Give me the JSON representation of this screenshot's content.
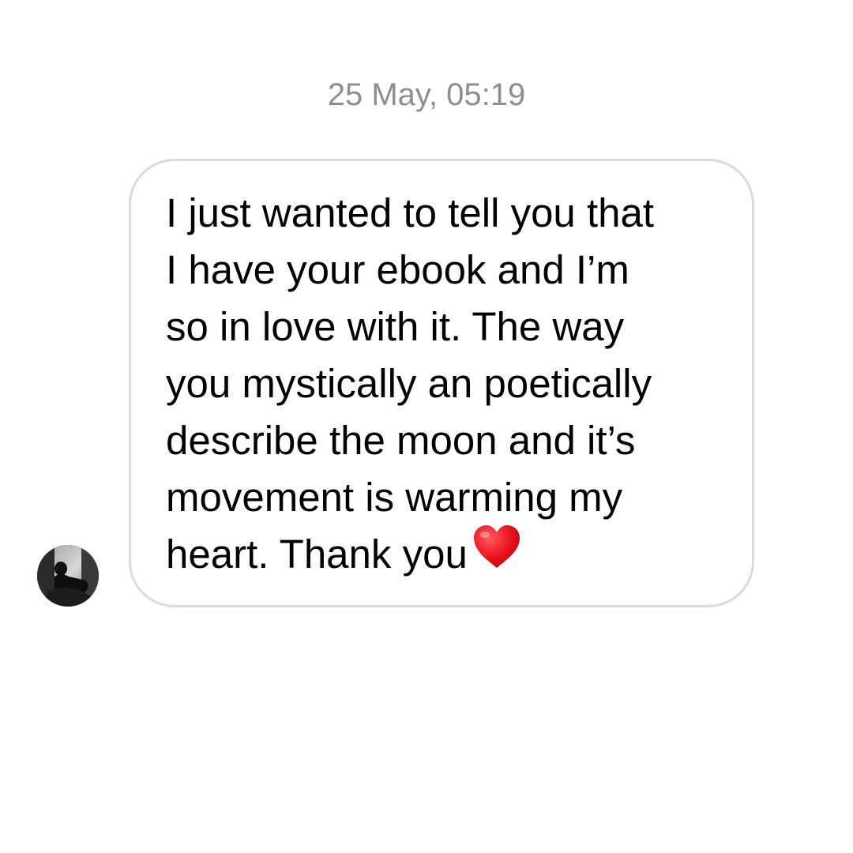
{
  "thread": {
    "timestamp": "25 May, 05:19",
    "message": {
      "text": "I just wanted to tell you that\nI have your ebook and I’m\nso in love with it. The way\nyou mystically an poetically\ndescribe the moon and it’s\nmovement is warming my\nheart. Thank you",
      "emoji": "heart-icon",
      "emoji_color": "#e8101d"
    },
    "avatar": "avatar-photo"
  },
  "colors": {
    "background": "#ffffff",
    "timestamp": "#8e8e8e",
    "bubble_border": "#dbdbdb",
    "text": "#000000"
  }
}
